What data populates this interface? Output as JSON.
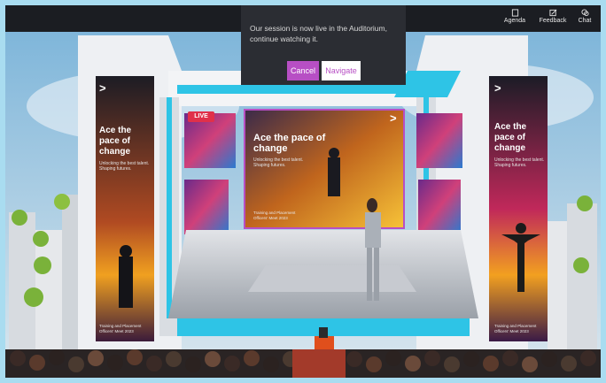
{
  "toolbar": {
    "agenda_label": "Agenda",
    "feedback_label": "Feedback",
    "chat_label": "Chat"
  },
  "session_popup": {
    "message": "Our session is now live in the Auditorium, continue watching it.",
    "cancel_label": "Cancel",
    "navigate_label": "Navigate"
  },
  "stage": {
    "live_badge": "LIVE",
    "screen": {
      "chevron": ">",
      "title": "Ace the pace of change",
      "subtitle": "Unlocking the best talent. Shaping futures.",
      "footer": "Training and Placement Officers' Meet 2023"
    },
    "left_banner": {
      "chevron": ">",
      "title": "Ace the pace of change",
      "subtitle": "Unlocking the best talent. Shaping futures.",
      "footer": "Training and Placement Officers' Meet 2023"
    },
    "right_banner": {
      "chevron": ">",
      "title": "Ace the pace of change",
      "subtitle": "Unlocking the best talent. Shaping futures.",
      "footer": "Training and Placement Officers' Meet 2023"
    }
  },
  "colors": {
    "accent": "#b74fc4",
    "live": "#e0304a",
    "cyan": "#2ec4e6"
  }
}
